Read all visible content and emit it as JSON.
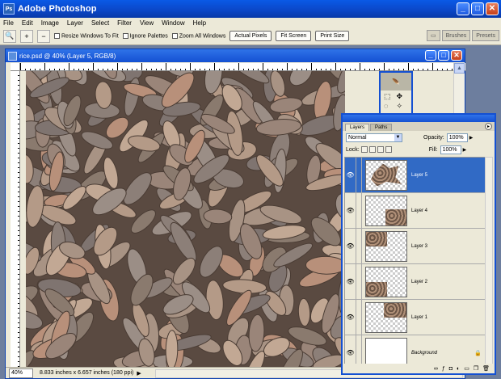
{
  "app": {
    "title": "Adobe Photoshop",
    "logo": "Ps"
  },
  "menu": [
    "File",
    "Edit",
    "Image",
    "Layer",
    "Select",
    "Filter",
    "View",
    "Window",
    "Help"
  ],
  "options": {
    "tool_icon": "zoom-icon",
    "resize_windows": "Resize Windows To Fit",
    "ignore_palettes": "Ignore Palettes",
    "zoom_all": "Zoom All Windows",
    "actual_pixels": "Actual Pixels",
    "fit_screen": "Fit Screen",
    "print_size": "Print Size",
    "wells": [
      "Brushes",
      "Presets"
    ]
  },
  "document": {
    "title": "rice.psd @ 40% (Layer 5, RGB/8)",
    "zoom": "40%",
    "info": "8.833 inches x 6.657 inches (180 ppi)"
  },
  "layers_palette": {
    "tabs": [
      "Layers",
      "Paths"
    ],
    "blend_mode": "Normal",
    "opacity_label": "Opacity:",
    "opacity": "100%",
    "lock_label": "Lock:",
    "fill_label": "Fill:",
    "fill": "100%",
    "layers": [
      {
        "name": "Layer 5",
        "active": true
      },
      {
        "name": "Layer 4",
        "active": false
      },
      {
        "name": "Layer 3",
        "active": false
      },
      {
        "name": "Layer 2",
        "active": false
      },
      {
        "name": "Layer 1",
        "active": false
      },
      {
        "name": "Background",
        "active": false
      }
    ]
  },
  "colors": {
    "titlebar": "#0b46c6",
    "chrome": "#ece9d8",
    "selection": "#316ac5"
  }
}
